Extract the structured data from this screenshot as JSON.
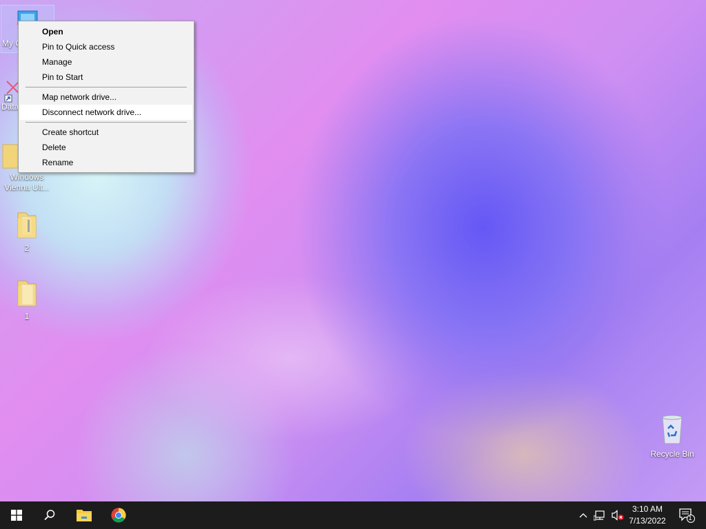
{
  "desktop": {
    "icons": [
      {
        "name": "My Computer",
        "label": "My C"
      },
      {
        "name": "Data",
        "label": "Data"
      },
      {
        "name": "Windows Vienna Ult",
        "label_line1": "Windows",
        "label_line2": "Vienna Ult..."
      },
      {
        "name": "2",
        "label": "2"
      },
      {
        "name": "1",
        "label": "1"
      },
      {
        "name": "Recycle Bin",
        "label": "Recycle Bin"
      }
    ]
  },
  "context_menu": {
    "items": [
      {
        "label": "Open",
        "bold": true
      },
      {
        "label": "Pin to Quick access"
      },
      {
        "label": "Manage"
      },
      {
        "label": "Pin to Start"
      },
      {
        "label": "Map network drive..."
      },
      {
        "label": "Disconnect network drive...",
        "highlighted": true
      },
      {
        "label": "Create shortcut"
      },
      {
        "label": "Delete"
      },
      {
        "label": "Rename"
      }
    ]
  },
  "taskbar": {
    "icons": [
      "windows-start-icon",
      "search-icon",
      "file-explorer-icon",
      "chrome-icon"
    ],
    "tray_icons": [
      "chevron-up-icon",
      "network-icon",
      "volume-muted-icon",
      "notification-icon"
    ],
    "clock": {
      "time": "3:10 AM",
      "date": "7/13/2022"
    },
    "notification_count": "1"
  },
  "colors": {
    "taskbar_bg": "#1c1c1c",
    "menu_bg": "#f2f2f2",
    "menu_hover": "#ffffff"
  }
}
